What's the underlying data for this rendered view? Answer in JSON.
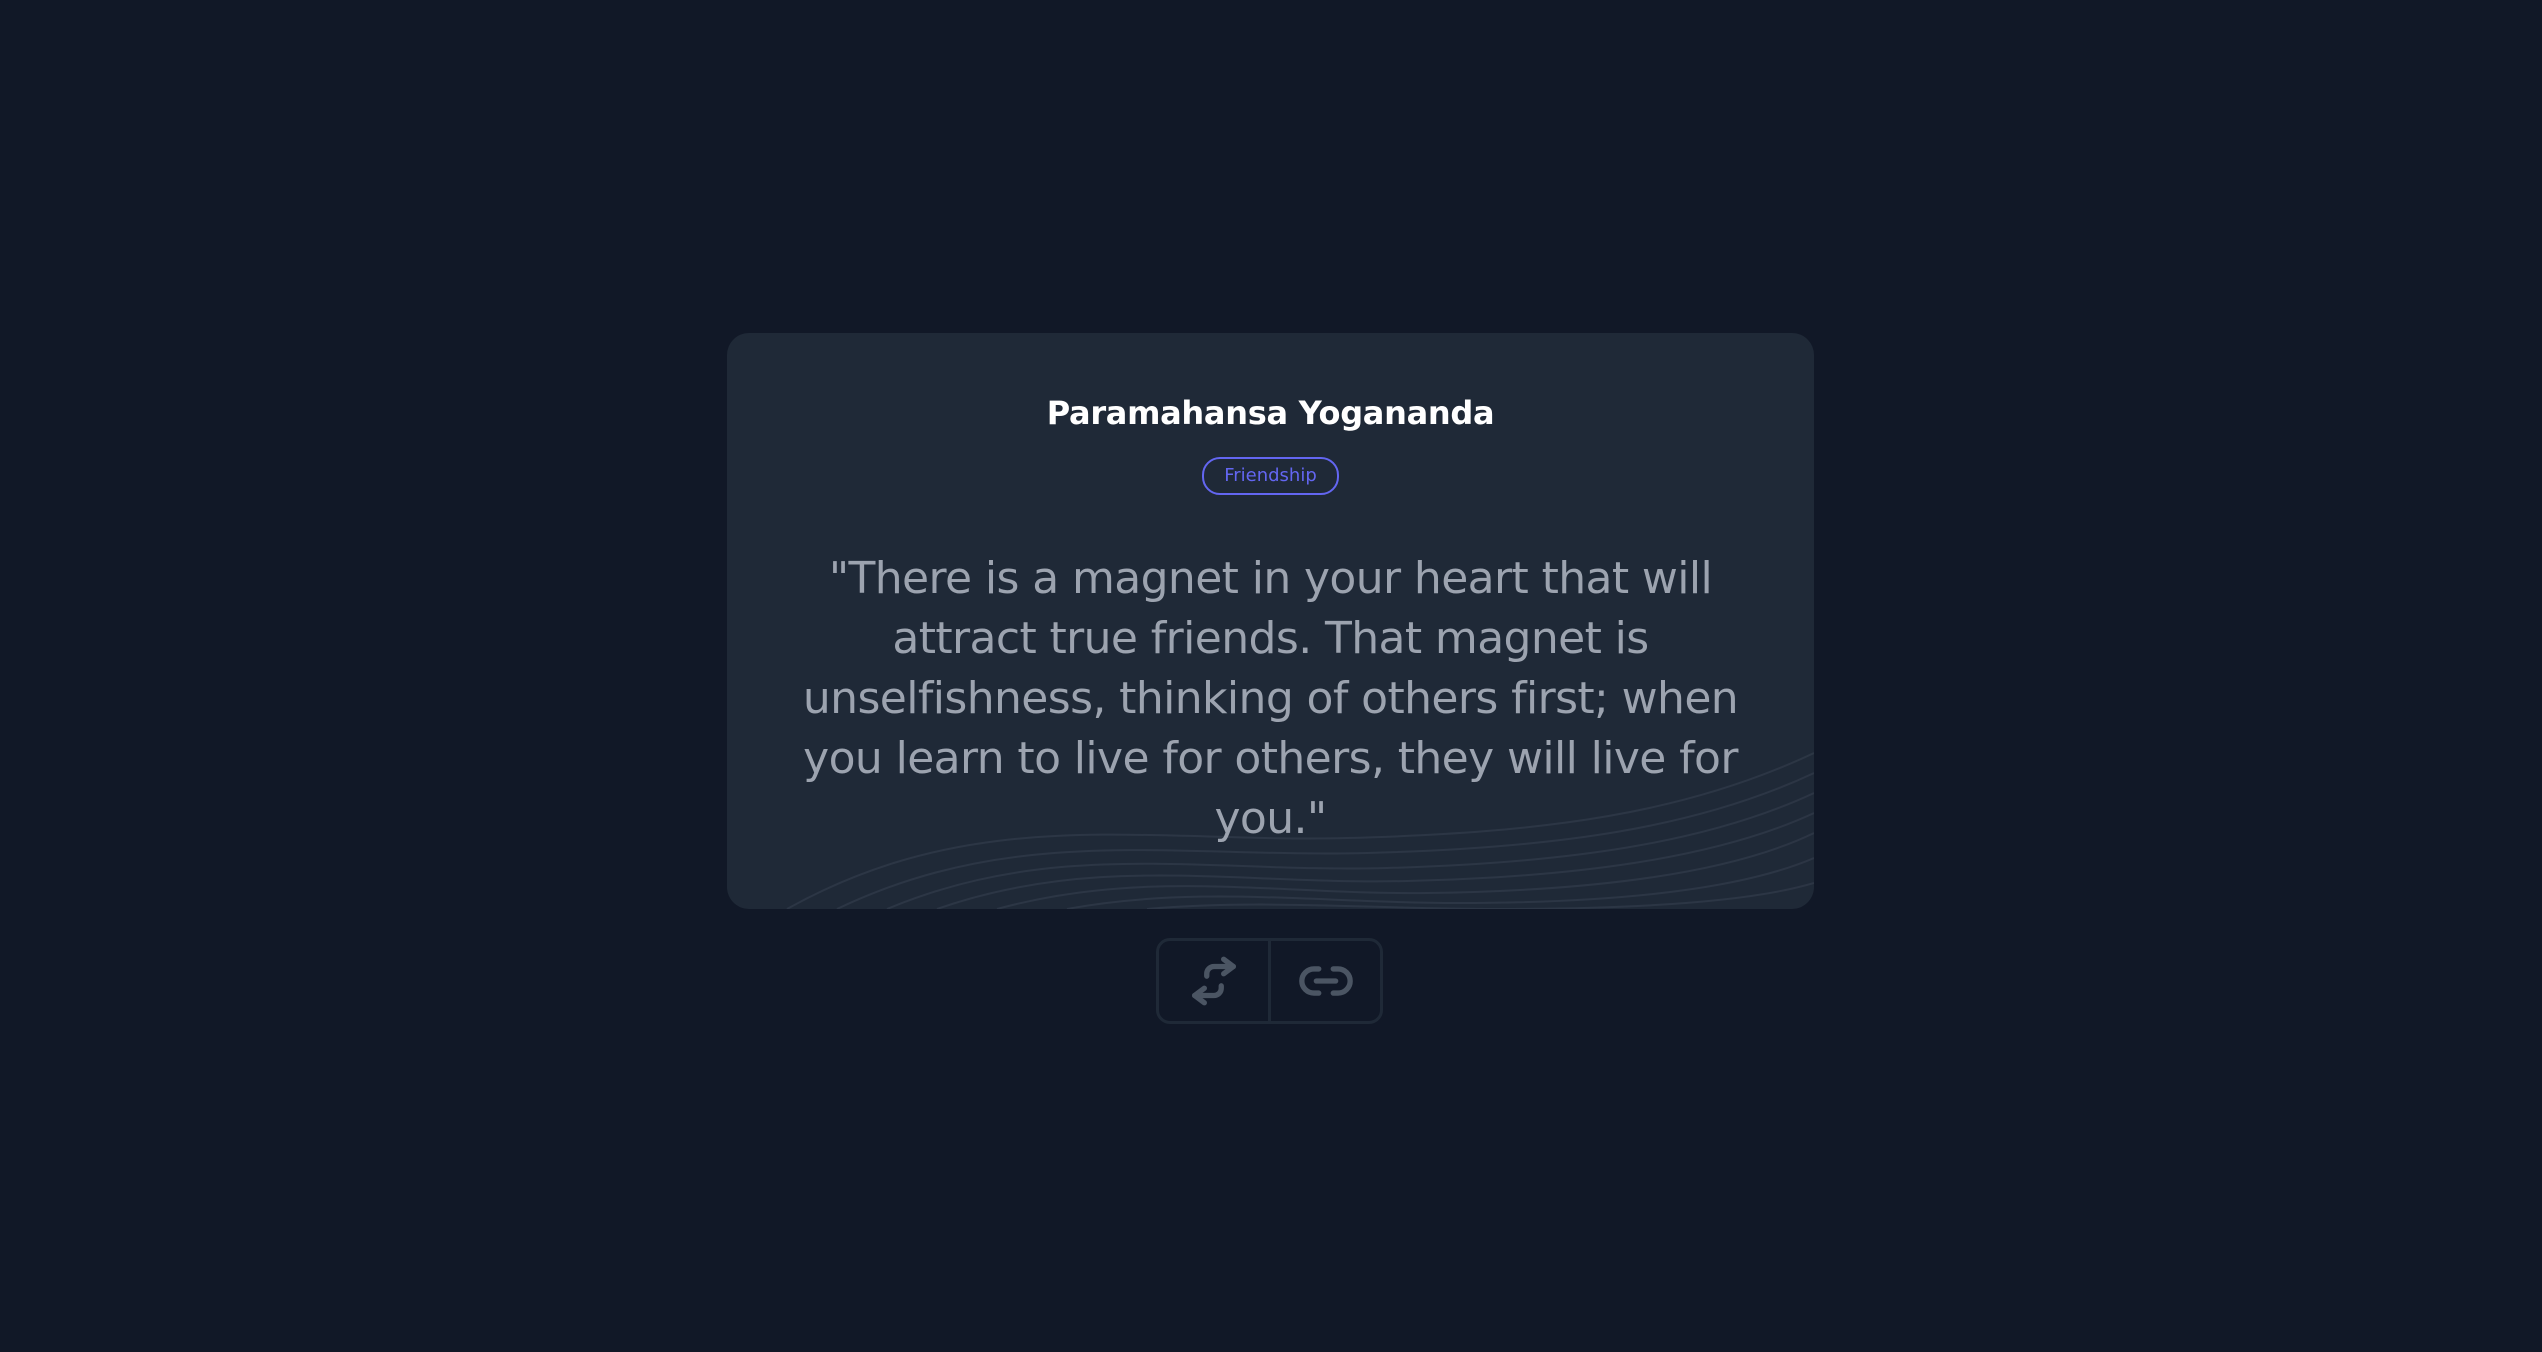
{
  "quote_card": {
    "author": "Paramahansa Yogananda",
    "tag": "Friendship",
    "text": "\"There is a magnet in your heart that will attract true friends. That magnet is unselfishness, thinking of others first; when you learn to live for others, they will live for you.\""
  },
  "actions": {
    "new_quote_icon": "swap-arrows-icon",
    "copy_link_icon": "link-icon"
  },
  "colors": {
    "background": "#111827",
    "card": "#1f2937",
    "accent": "#6366f1",
    "quote_text": "#9ca3af",
    "icon": "#4b5563"
  }
}
